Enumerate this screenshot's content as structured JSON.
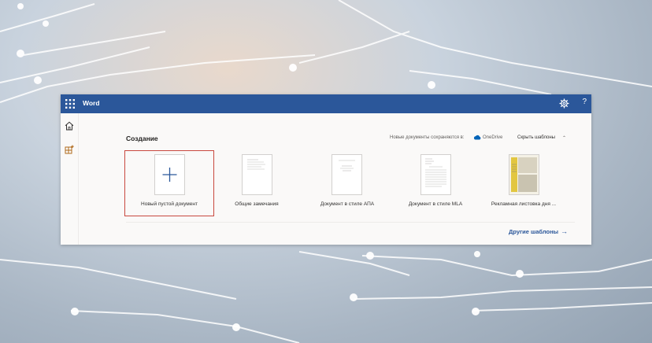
{
  "app": {
    "name": "Word",
    "brand_color": "#2b579a",
    "selection_color": "#c8483f"
  },
  "header": {
    "waffle_icon": "app-launcher-icon",
    "settings_icon": "gear-icon",
    "help_label": "?"
  },
  "nav": {
    "items": [
      {
        "icon": "home-icon"
      },
      {
        "icon": "new-document-icon"
      }
    ]
  },
  "create": {
    "title": "Создание",
    "save_note": "Новые документы сохраняются в:",
    "save_location": "OneDrive",
    "hide_templates": "Скрыть шаблоны",
    "more_templates": "Другие шаблоны",
    "templates": [
      {
        "label": "Новый пустой документ",
        "selected": true
      },
      {
        "label": "Общие замечания"
      },
      {
        "label": "Документ в стиле АПА"
      },
      {
        "label": "Документ в стиле MLA"
      },
      {
        "label": "Рекламная листовка дня ..."
      }
    ]
  }
}
